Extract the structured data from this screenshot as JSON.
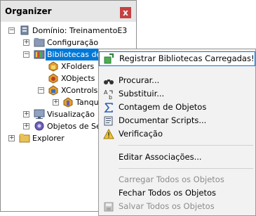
{
  "panel": {
    "title": "Organizer",
    "close_glyph": "x"
  },
  "tree": {
    "domain": "Domínio: TreinamentoE3",
    "config": "Configuração",
    "libs": "Bibliotecas de C",
    "xfolders": "XFolders",
    "xobjects": "XObjects",
    "xcontrols": "XControls",
    "tanque": "Tanque",
    "visual": "Visualização",
    "servers": "Objetos de Ser",
    "explorer": "Explorer",
    "exp_plus": "+",
    "exp_minus": "−"
  },
  "menu": {
    "register": "Registrar Bibliotecas Carregadas!",
    "find": "Procurar...",
    "replace": "Substituir...",
    "count": "Contagem de Objetos",
    "document": "Documentar Scripts...",
    "verify": "Verificação",
    "edit_assoc": "Editar Associações...",
    "load_all": "Carregar Todos os Objetos",
    "close_all": "Fechar Todos os Objetos",
    "save_all": "Salvar Todos os Objetos"
  },
  "colors": {
    "selection": "#0078d7",
    "close_button": "#c54141"
  },
  "icons": [
    "close-icon",
    "domain-icon",
    "folder-icon",
    "library-icon",
    "xfolder-icon",
    "xobject-icon",
    "xcontrol-icon",
    "tank-icon",
    "display-icon",
    "server-objects-icon",
    "explorer-folder-icon",
    "register-icon",
    "binoculars-icon",
    "replace-icon",
    "sigma-icon",
    "document-icon",
    "warning-icon",
    "save-icon"
  ]
}
